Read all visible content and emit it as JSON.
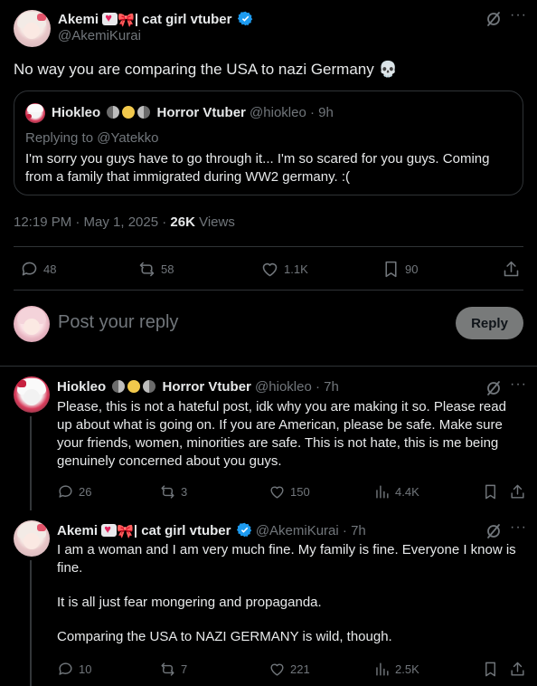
{
  "main_post": {
    "display_name": "cat girl vtuber",
    "display_name_prefix": "Akemi",
    "display_name_sep": "|",
    "handle": "@AkemiKurai",
    "text": "No way you are comparing the USA to nazi Germany 💀",
    "timestamp": "12:19 PM · May 1, 2025 · ",
    "views_count": "26K",
    "views_label": " Views",
    "stats": {
      "replies": "48",
      "reposts": "58",
      "likes": "1.1K",
      "bookmarks": "90"
    }
  },
  "quoted_post": {
    "display_name": "Hiokleo",
    "title": "Horror Vtuber",
    "handle": "@hiokleo",
    "time": "· 9h",
    "replying_to": "Replying to @Yatekko",
    "text": "I'm sorry you guys have to go through it... I'm so scared for you guys. Coming from a family that immigrated during WW2 germany. :("
  },
  "composer": {
    "placeholder": "Post your reply",
    "reply_button": "Reply"
  },
  "replies": [
    {
      "display_name": "Hiokleo",
      "title": "Horror Vtuber",
      "handle": "@hiokleo",
      "time": "· 7h",
      "text": "Please, this is not a hateful post, idk why you are making it so. Please read up about what is going on. If you are American, please be safe. Make sure your friends, women, minorities are safe. This is not hate, this is me being genuinely concerned about you guys.",
      "stats": {
        "replies": "26",
        "reposts": "3",
        "likes": "150",
        "views": "4.4K"
      }
    },
    {
      "display_name_prefix": "Akemi",
      "display_name": "cat girl vtuber",
      "display_name_sep": "|",
      "handle": "@AkemiKurai",
      "time": "· 7h",
      "text_p1": "I am a woman and I am very much fine. My family is fine. Everyone I know is fine.",
      "text_p2": "It is all just fear mongering and propaganda.",
      "text_p3": "Comparing the USA to NAZI GERMANY is wild, though.",
      "stats": {
        "replies": "10",
        "reposts": "7",
        "likes": "221",
        "views": "2.5K"
      }
    }
  ],
  "icons": {
    "verified": "verified-badge-icon",
    "grok": "grok-icon",
    "more": "more-icon",
    "reply": "reply-icon",
    "repost": "repost-icon",
    "like": "like-icon",
    "bookmark": "bookmark-icon",
    "share": "share-icon",
    "views": "views-icon"
  },
  "colors": {
    "accent": "#1d9bf0",
    "muted": "#71767b",
    "text": "#e7e9ea",
    "border": "#2f3336"
  }
}
